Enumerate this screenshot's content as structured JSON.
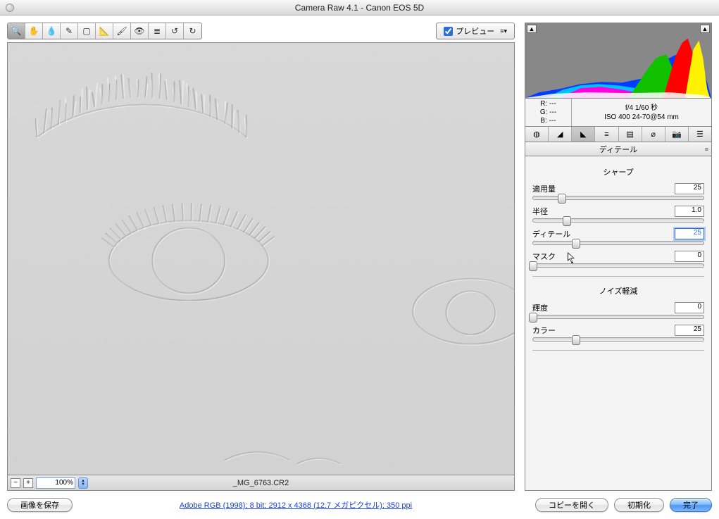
{
  "window": {
    "title": "Camera Raw 4.1  -  Canon EOS 5D"
  },
  "toolbar": {
    "preview_label": "プレビュー",
    "tools": [
      {
        "name": "zoom",
        "glyph": "🔍",
        "active": true
      },
      {
        "name": "hand",
        "glyph": "✋"
      },
      {
        "name": "wb",
        "glyph": "💧"
      },
      {
        "name": "sampler",
        "glyph": "✎"
      },
      {
        "name": "crop",
        "glyph": "▢"
      },
      {
        "name": "straighten",
        "glyph": "📐"
      },
      {
        "name": "retouch",
        "glyph": "🖌"
      },
      {
        "name": "redeye",
        "glyph": "👁"
      },
      {
        "name": "prefs",
        "glyph": "≣"
      },
      {
        "name": "rotate-ccw",
        "glyph": "↺"
      },
      {
        "name": "rotate-cw",
        "glyph": "↻"
      }
    ]
  },
  "zoom": {
    "minus": "−",
    "plus": "+",
    "value": "100%"
  },
  "filename": "_MG_6763.CR2",
  "link": "Adobe RGB (1998); 8 bit; 2912 x 4368 (12.7 メガピクセル); 350 ppi",
  "buttons": {
    "save": "画像を保存",
    "open_copy": "コピーを開く",
    "reset": "初期化",
    "done": "完了"
  },
  "exif": {
    "r": "R:   ---",
    "g": "G:   ---",
    "b": "B:   ---",
    "line1": "f/4    1/60 秒",
    "line2": "ISO 400    24-70@54 mm"
  },
  "tabs": [
    {
      "name": "basic",
      "glyph": "◍"
    },
    {
      "name": "curve",
      "glyph": "◢"
    },
    {
      "name": "detail",
      "glyph": "◣",
      "active": true
    },
    {
      "name": "hsl",
      "glyph": "≡"
    },
    {
      "name": "split",
      "glyph": "▤"
    },
    {
      "name": "lens",
      "glyph": "⌀"
    },
    {
      "name": "cal",
      "glyph": "📷"
    },
    {
      "name": "preset",
      "glyph": "☰"
    }
  ],
  "panel_title": "ディテール",
  "sections": {
    "sharpen": "シャープ",
    "noise": "ノイズ軽減"
  },
  "sliders": {
    "amount": {
      "label": "適用量",
      "value": "25",
      "pos": 17
    },
    "radius": {
      "label": "半径",
      "value": "1.0",
      "pos": 20
    },
    "detail": {
      "label": "ディテール",
      "value": "25",
      "pos": 25,
      "focused": true
    },
    "mask": {
      "label": "マスク",
      "value": "0",
      "pos": 0
    },
    "luminance": {
      "label": "輝度",
      "value": "0",
      "pos": 0
    },
    "color": {
      "label": "カラー",
      "value": "25",
      "pos": 25
    }
  },
  "hist_warn": "▲"
}
